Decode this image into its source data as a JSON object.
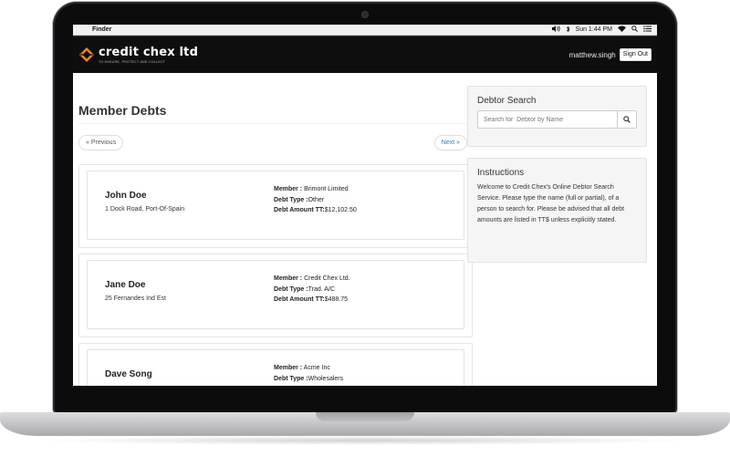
{
  "menubar": {
    "apple_icon": "",
    "app_name": "Finder",
    "clock": "Sun 1:44 PM",
    "icons": [
      "volume-icon",
      "bluetooth-icon",
      "wifi-icon",
      "spotlight-icon",
      "notification-list-icon"
    ]
  },
  "header": {
    "brand_name": "credit chex ltd",
    "tagline": "TO ENSURE, PROTECT AND COLLECT",
    "username": "matthew.singh",
    "signout_label": "Sign Out",
    "brand_color": "#e8862a"
  },
  "main": {
    "title": "Member Debts",
    "previous_label": "« Previous",
    "next_label": "Next »"
  },
  "debts": [
    {
      "name": "John Doe",
      "address": "1 Dock Road, Port-Of-Spain",
      "member_label": "Member :",
      "member": " Brimont Limited",
      "type_label": "Debt Type :",
      "type": "Other",
      "amount_label": "Debt Amount TT:",
      "amount": "$12,102.50"
    },
    {
      "name": "Jane Doe",
      "address": "25 Fernandes Ind Est",
      "member_label": "Member :",
      "member": " Credit Chex Ltd.",
      "type_label": "Debt Type :",
      "type": "Trad. A/C",
      "amount_label": "Debt Amount TT:",
      "amount": "$488.75"
    },
    {
      "name": "Dave Song",
      "address": "",
      "member_label": "Member :",
      "member": " Acme Inc",
      "type_label": "Debt Type :",
      "type": "Wholesalers",
      "amount_label": "",
      "amount": ""
    }
  ],
  "sidebar": {
    "search_title": "Debtor Search",
    "search_placeholder": "Search for  Debtor by Name",
    "instructions_title": "Instructions",
    "instructions_text": "Welcome to Credit Chex's Online Debtor Search Service. Please type the name (full or partial), of a person to search for. Please be advised that all debt amounts are listed in TT$ unless explicitly stated."
  }
}
